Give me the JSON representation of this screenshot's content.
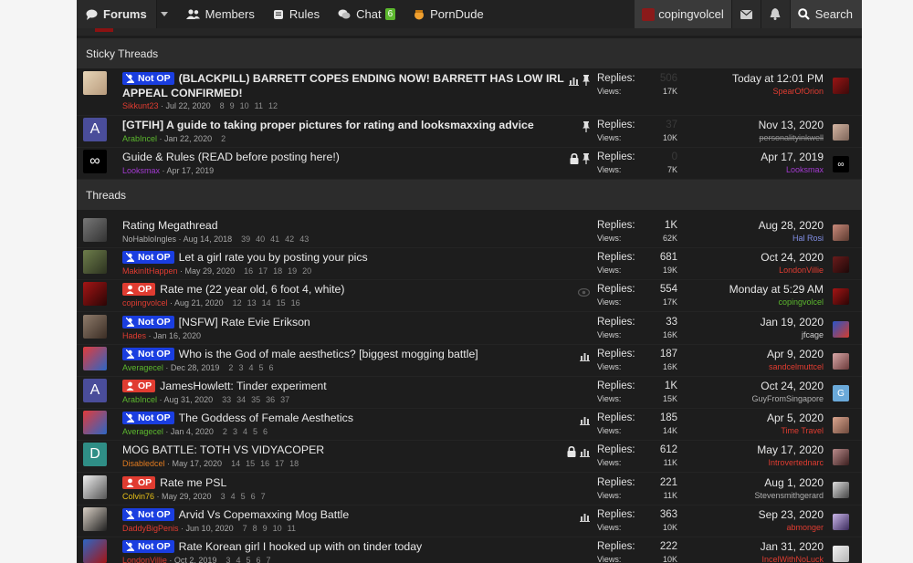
{
  "nav": {
    "forums": "Forums",
    "members": "Members",
    "rules": "Rules",
    "chat": "Chat",
    "chat_badge": "6",
    "porndude": "PornDude",
    "username": "copingvolcel",
    "search": "Search"
  },
  "sections": {
    "sticky": "Sticky Threads",
    "threads": "Threads"
  },
  "labels": {
    "replies": "Replies:",
    "views": "Views:"
  },
  "prefix_labels": {
    "notop": "Not OP",
    "op": "OP"
  },
  "colors": {
    "notop": "#1a3ee0",
    "op": "#e03c31",
    "background": "#1d1d1d",
    "header": "#2c2c2c"
  },
  "sticky": [
    {
      "prefix": "Not OP",
      "title": "(BLACKPILL) BARRETT COPES ENDING NOW! BARRETT HAS LOW IRL",
      "title2": "APPEAL CONFIRMED!",
      "author": "Sikkunt23",
      "date": "Jul 22, 2020",
      "pages": "8 9 10 11 12",
      "icons": [
        "bar-chart-icon",
        "pin-icon"
      ],
      "replies": "506",
      "views": "17K",
      "last_date": "Today at 12:01 PM",
      "last_user": "SpearOfOrion"
    },
    {
      "prefix": "",
      "title": "[GTFIH] A guide to taking proper pictures for rating and looksmaxxing advice",
      "author": "ArabIncel",
      "date": "Jan 22, 2020",
      "pages": "2",
      "icons": [
        "pin-icon"
      ],
      "replies": "37",
      "views": "10K",
      "last_date": "Nov 13, 2020",
      "last_user": "personalityinkwell"
    },
    {
      "prefix": "",
      "title": "Guide & Rules (READ before posting here!)",
      "author": "Looksmax",
      "date": "Apr 17, 2019",
      "pages": "",
      "icons": [
        "lock-icon",
        "pin-icon"
      ],
      "replies": "0",
      "views": "7K",
      "last_date": "Apr 17, 2019",
      "last_user": "Looksmax"
    }
  ],
  "threads": [
    {
      "prefix": "",
      "title": "Rating Megathread",
      "author": "NoHabloIngles",
      "date": "Aug 14, 2018",
      "pages": "39 40 41 42 43",
      "icons": [],
      "replies": "1K",
      "views": "62K",
      "last_date": "Aug 28, 2020",
      "last_user": "Hal Rosi"
    },
    {
      "prefix": "Not OP",
      "title": "Let a girl rate you by posting your pics",
      "author": "MakinItHappen",
      "date": "May 29, 2020",
      "pages": "16 17 18 19 20",
      "icons": [],
      "replies": "681",
      "views": "19K",
      "last_date": "Oct 24, 2020",
      "last_user": "LondonVillie"
    },
    {
      "prefix": "OP",
      "title": "Rate me (22 year old, 6 foot 4, white)",
      "author": "copingvolcel",
      "date": "Aug 21, 2020",
      "pages": "12 13 14 15 16",
      "icons": [
        "eye-icon"
      ],
      "replies": "554",
      "views": "17K",
      "last_date": "Monday at 5:29 AM",
      "last_user": "copingvolcel"
    },
    {
      "prefix": "Not OP",
      "title": "[NSFW] Rate Evie Erikson",
      "author": "Hades",
      "date": "Jan 16, 2020",
      "pages": "",
      "icons": [],
      "replies": "33",
      "views": "16K",
      "last_date": "Jan 19, 2020",
      "last_user": "jfcage"
    },
    {
      "prefix": "Not OP",
      "title": "Who is the God of male aesthetics? [biggest mogging battle]",
      "author": "Averagecel",
      "date": "Dec 28, 2019",
      "pages": "2 3 4 5 6",
      "icons": [
        "bar-chart-icon"
      ],
      "replies": "187",
      "views": "16K",
      "last_date": "Apr 9, 2020",
      "last_user": "sandcelmuttcel"
    },
    {
      "prefix": "OP",
      "title": "JamesHowlett: Tinder experiment",
      "author": "ArabIncel",
      "date": "Aug 31, 2020",
      "pages": "33 34 35 36 37",
      "icons": [],
      "replies": "1K",
      "views": "15K",
      "last_date": "Oct 24, 2020",
      "last_user": "GuyFromSingapore"
    },
    {
      "prefix": "Not OP",
      "title": "The Goddess of Female Aesthetics",
      "author": "Averagecel",
      "date": "Jan 4, 2020",
      "pages": "2 3 4 5 6",
      "icons": [
        "bar-chart-icon"
      ],
      "replies": "185",
      "views": "14K",
      "last_date": "Apr 5, 2020",
      "last_user": "Time Travel"
    },
    {
      "prefix": "",
      "title": "MOG BATTLE: TOTH VS VIDYACOPER",
      "author": "Disabledcel",
      "date": "May 17, 2020",
      "pages": "14 15 16 17 18",
      "icons": [
        "lock-icon",
        "bar-chart-icon"
      ],
      "replies": "612",
      "views": "11K",
      "last_date": "May 17, 2020",
      "last_user": "Introvertednarc"
    },
    {
      "prefix": "OP",
      "title": "Rate me PSL",
      "author": "Colvin76",
      "date": "May 29, 2020",
      "pages": "3 4 5 6 7",
      "icons": [],
      "replies": "221",
      "views": "11K",
      "last_date": "Aug 1, 2020",
      "last_user": "Stevensmithgerard"
    },
    {
      "prefix": "Not OP",
      "title": "Arvid Vs Copemaxxing Mog Battle",
      "author": "DaddyBigPenis",
      "date": "Jun 10, 2020",
      "pages": "7 8 9 10 11",
      "icons": [
        "bar-chart-icon"
      ],
      "replies": "363",
      "views": "10K",
      "last_date": "Sep 23, 2020",
      "last_user": "abmonger"
    },
    {
      "prefix": "Not OP",
      "title": "Rate Korean girl I hooked up with on tinder today",
      "author": "LondonVillie",
      "date": "Oct 2, 2019",
      "pages": "3 4 5 6 7",
      "icons": [],
      "replies": "222",
      "views": "10K",
      "last_date": "Jan 31, 2020",
      "last_user": "IncelWithNoLuck"
    }
  ]
}
